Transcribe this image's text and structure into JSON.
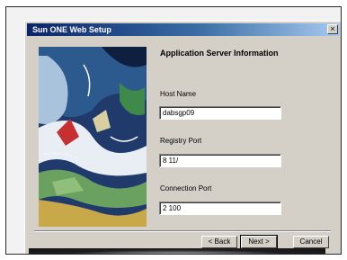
{
  "window": {
    "title": "Sun ONE Web Setup",
    "close_glyph": "×"
  },
  "page": {
    "heading": "Application Server Information"
  },
  "fields": [
    {
      "label": "Host Name",
      "value": "dabsgp09"
    },
    {
      "label": "Registry Port",
      "value": "8 11/"
    },
    {
      "label": "Connection Port",
      "value": "2 100"
    }
  ],
  "buttons": {
    "back_label": "< Back",
    "next_label": "Next >",
    "cancel_label": "Cancel"
  },
  "colors": {
    "dialog_bg": "#d4d0c8",
    "titlebar_start": "#0a246a",
    "titlebar_end": "#a6caf0"
  }
}
